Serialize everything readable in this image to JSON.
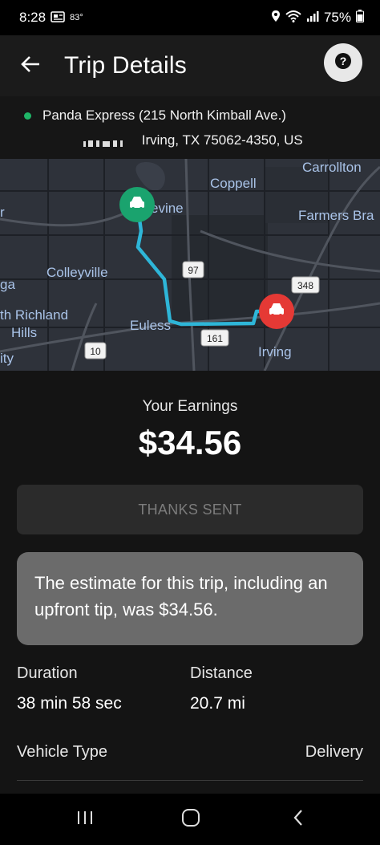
{
  "status_bar": {
    "time": "8:28",
    "temperature": "83°",
    "battery": "75%"
  },
  "header": {
    "title": "Trip Details"
  },
  "trip": {
    "pickup": "Panda Express (215 North Kimball Ave.)",
    "dropoff": "Irving, TX 75062-4350, US"
  },
  "map": {
    "labels": {
      "carrollton": "Carrollton",
      "coppell": "Coppell",
      "grapevine": "evine",
      "farmers_branch": "Farmers Bra",
      "colleyville": "Colleyville",
      "ga": "ga",
      "north_richland": "th Richland",
      "hills": "Hills",
      "city": "ity",
      "euless": "Euless",
      "irving": "Irving",
      "left_r": "r"
    },
    "shields": {
      "s97": "97",
      "s348": "348",
      "s161": "161",
      "s10": "10"
    },
    "colors": {
      "route": "#2eb6d8",
      "origin": "#1aa36e",
      "destination": "#e53935"
    }
  },
  "earnings": {
    "label": "Your Earnings",
    "amount": "$34.56"
  },
  "thanks_button": {
    "label": "THANKS SENT"
  },
  "estimate": {
    "text": "The estimate for this trip, including an upfront tip, was $34.56."
  },
  "stats": {
    "duration_label": "Duration",
    "duration_value": "38 min 58 sec",
    "distance_label": "Distance",
    "distance_value": "20.7 mi"
  },
  "vehicle": {
    "label": "Vehicle Type",
    "value": "Delivery"
  },
  "icons": {
    "back": "arrow-left-icon",
    "help": "question-mark-icon",
    "recents": "recents-icon",
    "home": "home-icon",
    "nav_back": "chevron-left-icon"
  }
}
